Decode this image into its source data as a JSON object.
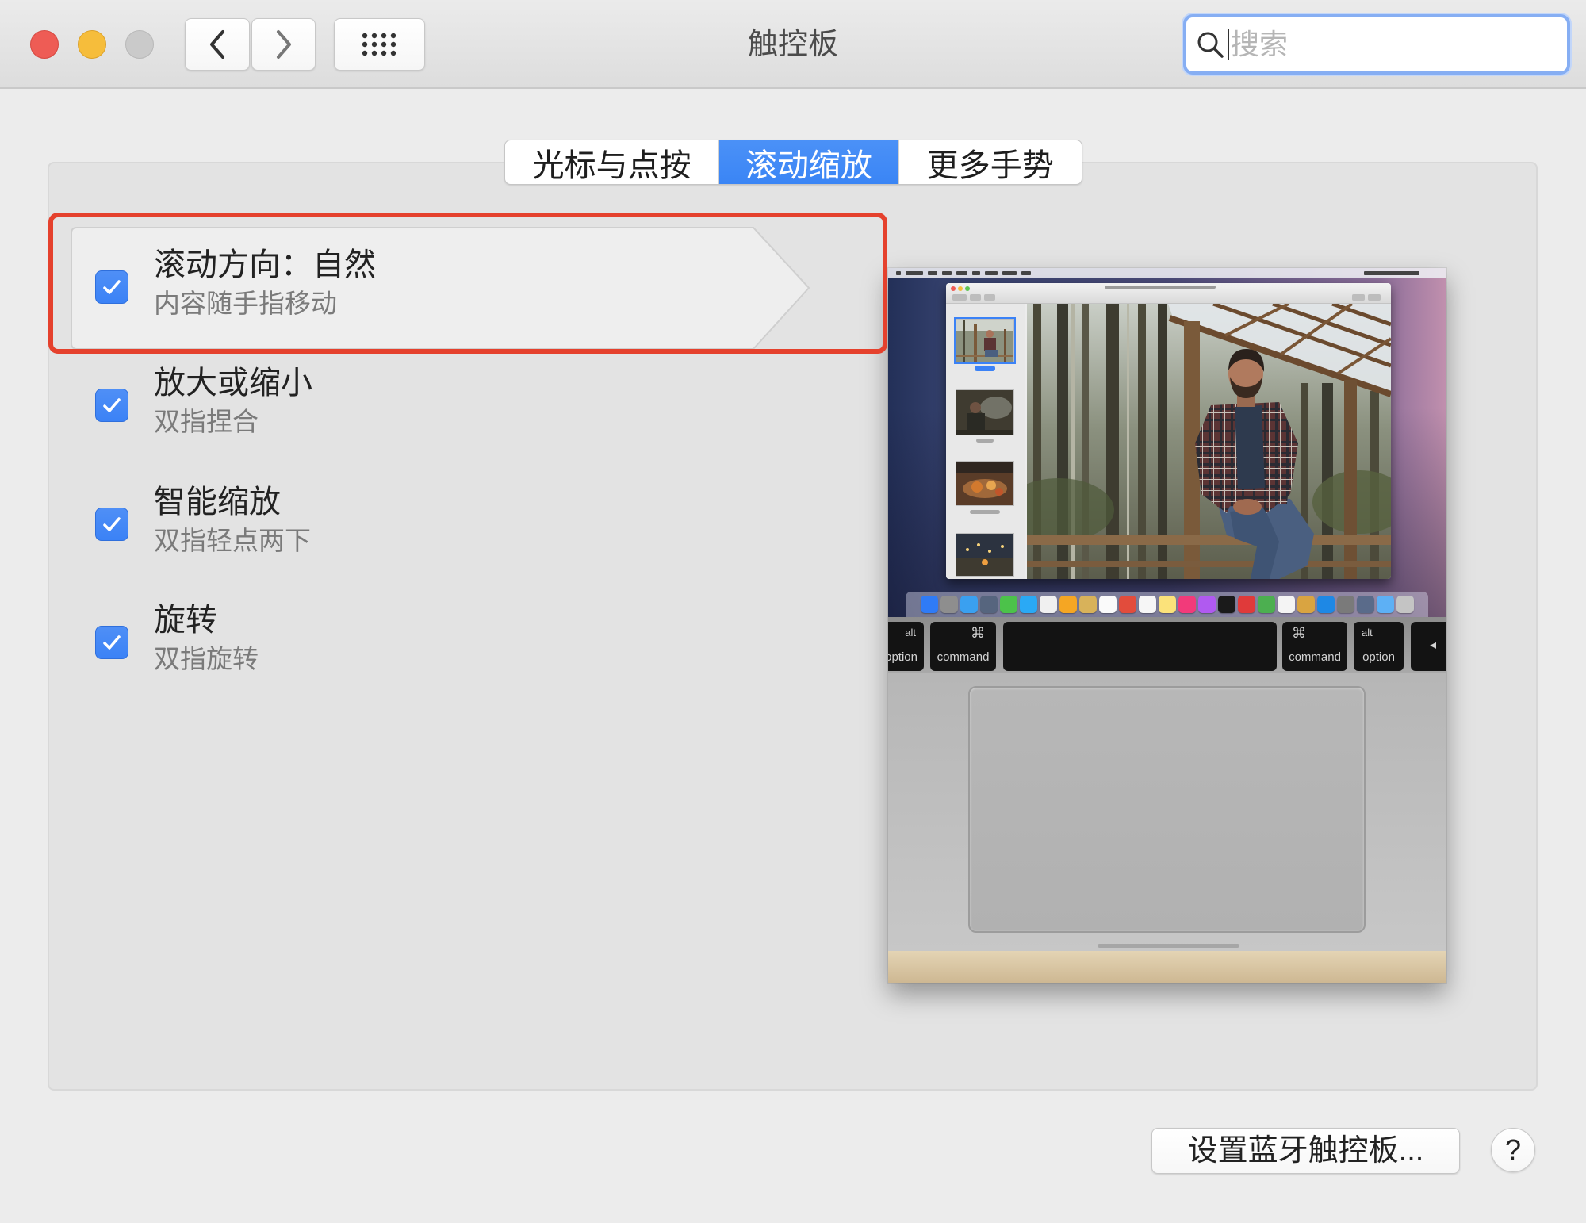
{
  "window": {
    "title": "触控板",
    "search": {
      "placeholder": "搜索",
      "value": ""
    }
  },
  "tabs": [
    {
      "label": "光标与点按",
      "selected": false
    },
    {
      "label": "滚动缩放",
      "selected": true
    },
    {
      "label": "更多手势",
      "selected": false
    }
  ],
  "options": [
    {
      "title": "滚动方向：自然",
      "subtitle": "内容随手指移动",
      "checked": true,
      "highlighted": true
    },
    {
      "title": "放大或缩小",
      "subtitle": "双指捏合",
      "checked": true,
      "highlighted": false
    },
    {
      "title": "智能缩放",
      "subtitle": "双指轻点两下",
      "checked": true,
      "highlighted": false
    },
    {
      "title": "旋转",
      "subtitle": "双指旋转",
      "checked": true,
      "highlighted": false
    }
  ],
  "preview": {
    "keys": {
      "left_option": {
        "symbol": "alt",
        "label": "option"
      },
      "left_command": {
        "symbol": "⌘",
        "label": "command"
      },
      "right_command": {
        "symbol": "⌘",
        "label": "command"
      },
      "right_option": {
        "symbol": "alt",
        "label": "option"
      },
      "arrow_left": {
        "symbol": "◂"
      }
    },
    "dock_icon_colors": [
      "#2f7bf6",
      "#8e8e8e",
      "#3aa0f0",
      "#56657e",
      "#4cc24a",
      "#2aa9f5",
      "#f0f0f0",
      "#f5a623",
      "#d8b25a",
      "#fafafa",
      "#e24c3c",
      "#f6f6f6",
      "#fbe27a",
      "#f23a7a",
      "#b05af0",
      "#1a1a1a",
      "#e03a3a",
      "#4caf50",
      "#f4f4f4",
      "#d9a441",
      "#1e88e5",
      "#7a7a7a",
      "#5a6b8a",
      "#5db0f5",
      "#c4c4c4"
    ]
  },
  "footer": {
    "bluetooth_button_label": "设置蓝牙触控板...",
    "help_button_label": "?"
  },
  "colors": {
    "accent": "#3b82f6",
    "selected_tab": "#3a85f5",
    "highlight_annotation": "#e5412d",
    "close": "#ee5c55",
    "minimize": "#f6bd3b",
    "zoom_disabled": "#cacaca"
  },
  "icons": {
    "back": "chevron-left-icon",
    "forward": "chevron-right-icon",
    "show_all": "grid-icon",
    "search": "search-icon",
    "checkbox": "checkmark-icon",
    "help": "question-mark-icon"
  }
}
